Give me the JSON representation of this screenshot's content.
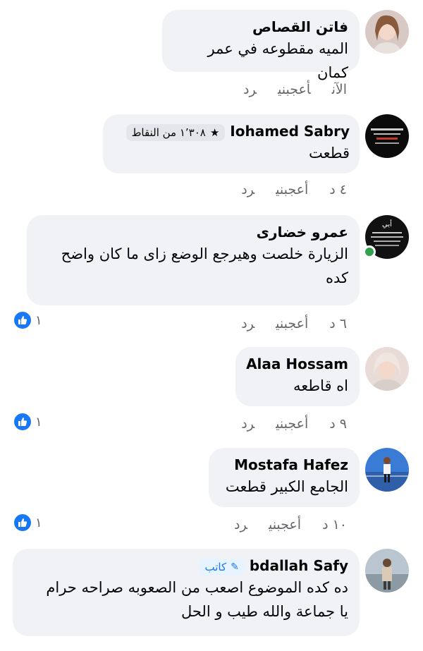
{
  "comments": [
    {
      "name": "فاتن القصاص",
      "text": "الميه مقطوعه في عمر كمان",
      "time": "الآن",
      "like_label": "أعجبني",
      "reply_label": "رد"
    },
    {
      "name": "Iohamed Sabry",
      "badge_text": "١٬٣٠٨ من النقاط",
      "badge_icon": "star-icon",
      "text": "قطعت",
      "time": "٤ د",
      "like_label": "أعجبني",
      "reply_label": "رد"
    },
    {
      "name": "عمرو خضارى",
      "text": "الزيارة خلصت وهيرجع الوضع زاى ما كان واضح كده",
      "time": "٦ د",
      "like_label": "أعجبني",
      "reply_label": "رد",
      "reactions": "١"
    },
    {
      "name": "Alaa Hossam",
      "text": "اه قاطعه",
      "time": "٩ د",
      "like_label": "أعجبني",
      "reply_label": "رد",
      "reactions": "١"
    },
    {
      "name": "Mostafa Hafez",
      "text": "الجامع الكبير قطعت",
      "time": "١٠ د",
      "like_label": "أعجبني",
      "reply_label": "رد",
      "reactions": "١"
    },
    {
      "name": "bdallah Safy",
      "author_badge": "كاتب",
      "author_icon": "pencil-icon",
      "text_line1": "ده كده الموضوع اصعب من الصعوبه صراحه حرام",
      "text_line2": "يا جماعة والله طيب و الحل"
    }
  ],
  "colors": {
    "bubble": "#f0f2f5",
    "meta": "#65676b",
    "like": "#1877f2",
    "online": "#31a24c"
  }
}
